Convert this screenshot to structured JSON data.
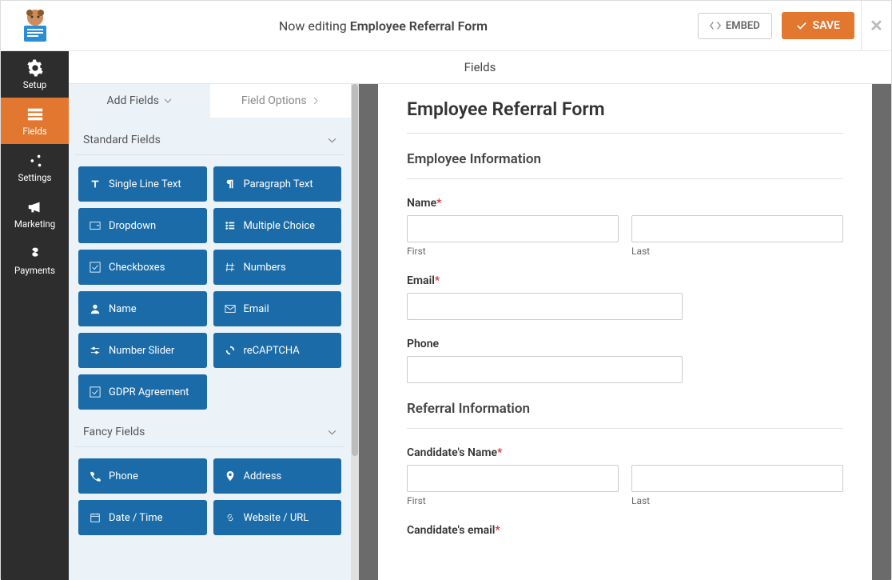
{
  "header": {
    "editing_prefix": "Now editing ",
    "form_name": "Employee Referral Form",
    "embed_label": "EMBED",
    "save_label": "SAVE"
  },
  "sidenav": {
    "setup": "Setup",
    "fields": "Fields",
    "settings": "Settings",
    "marketing": "Marketing",
    "payments": "Payments"
  },
  "panel_title": "Fields",
  "tabs": {
    "add_fields": "Add Fields",
    "field_options": "Field Options"
  },
  "sections": {
    "standard": "Standard Fields",
    "fancy": "Fancy Fields"
  },
  "standard_fields": {
    "single_line": "Single Line Text",
    "paragraph": "Paragraph Text",
    "dropdown": "Dropdown",
    "multiple_choice": "Multiple Choice",
    "checkboxes": "Checkboxes",
    "numbers": "Numbers",
    "name": "Name",
    "email": "Email",
    "number_slider": "Number Slider",
    "recaptcha": "reCAPTCHA",
    "gdpr": "GDPR Agreement"
  },
  "fancy_fields": {
    "phone": "Phone",
    "address": "Address",
    "datetime": "Date / Time",
    "website": "Website / URL"
  },
  "form": {
    "title": "Employee Referral Form",
    "section1": "Employee Information",
    "name_label": "Name",
    "first": "First",
    "last": "Last",
    "email_label": "Email",
    "phone_label": "Phone",
    "section2": "Referral Information",
    "cand_name_label": "Candidate's Name",
    "cand_email_label": "Candidate's email",
    "asterisk": "*"
  }
}
